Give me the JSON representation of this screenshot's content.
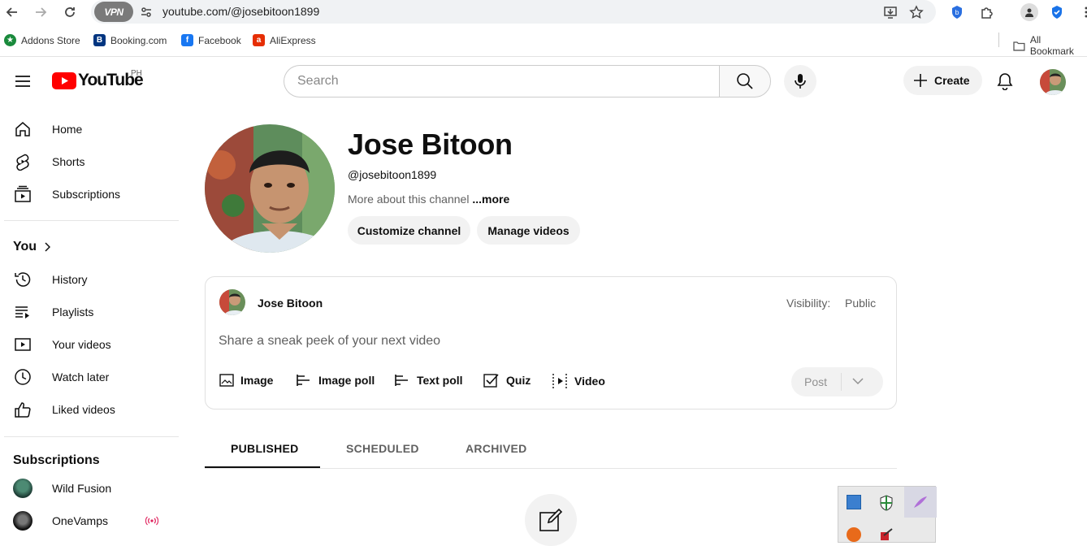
{
  "browser": {
    "vpn_label": "VPN",
    "url": "youtube.com/@josebitoon1899",
    "bookmarks": [
      {
        "label": "Addons Store",
        "icon": "addons-store-icon"
      },
      {
        "label": "Booking.com",
        "icon": "booking-icon"
      },
      {
        "label": "Facebook",
        "icon": "facebook-icon"
      },
      {
        "label": "AliExpress",
        "icon": "aliexpress-icon"
      }
    ],
    "all_bookmarks": "All Bookmark"
  },
  "header": {
    "logo_text": "YouTube",
    "country_code": "PH",
    "search_placeholder": "Search",
    "create_label": "Create"
  },
  "sidebar": {
    "primary": [
      {
        "label": "Home",
        "icon": "home-icon"
      },
      {
        "label": "Shorts",
        "icon": "shorts-icon"
      },
      {
        "label": "Subscriptions",
        "icon": "subscriptions-icon"
      }
    ],
    "you_label": "You",
    "you_items": [
      {
        "label": "History",
        "icon": "history-icon"
      },
      {
        "label": "Playlists",
        "icon": "playlists-icon"
      },
      {
        "label": "Your videos",
        "icon": "your-videos-icon"
      },
      {
        "label": "Watch later",
        "icon": "watch-later-icon"
      },
      {
        "label": "Liked videos",
        "icon": "liked-videos-icon"
      }
    ],
    "subscriptions_label": "Subscriptions",
    "subscriptions": [
      {
        "label": "Wild Fusion"
      },
      {
        "label": "OneVamps"
      }
    ]
  },
  "channel": {
    "name": "Jose Bitoon",
    "handle": "@josebitoon1899",
    "more_prefix": "More about this channel",
    "more_link": "...more",
    "customize_label": "Customize channel",
    "manage_label": "Manage videos"
  },
  "composer": {
    "author": "Jose Bitoon",
    "visibility_label": "Visibility:",
    "visibility_value": "Public",
    "placeholder": "Share a sneak peek of your next video",
    "tools": [
      {
        "label": "Image",
        "icon": "image-icon"
      },
      {
        "label": "Image poll",
        "icon": "image-poll-icon"
      },
      {
        "label": "Text poll",
        "icon": "text-poll-icon"
      },
      {
        "label": "Quiz",
        "icon": "quiz-icon"
      },
      {
        "label": "Video",
        "icon": "video-icon"
      }
    ],
    "post_label": "Post"
  },
  "tabs": [
    {
      "label": "PUBLISHED",
      "active": true
    },
    {
      "label": "SCHEDULED",
      "active": false
    },
    {
      "label": "ARCHIVED",
      "active": false
    }
  ]
}
